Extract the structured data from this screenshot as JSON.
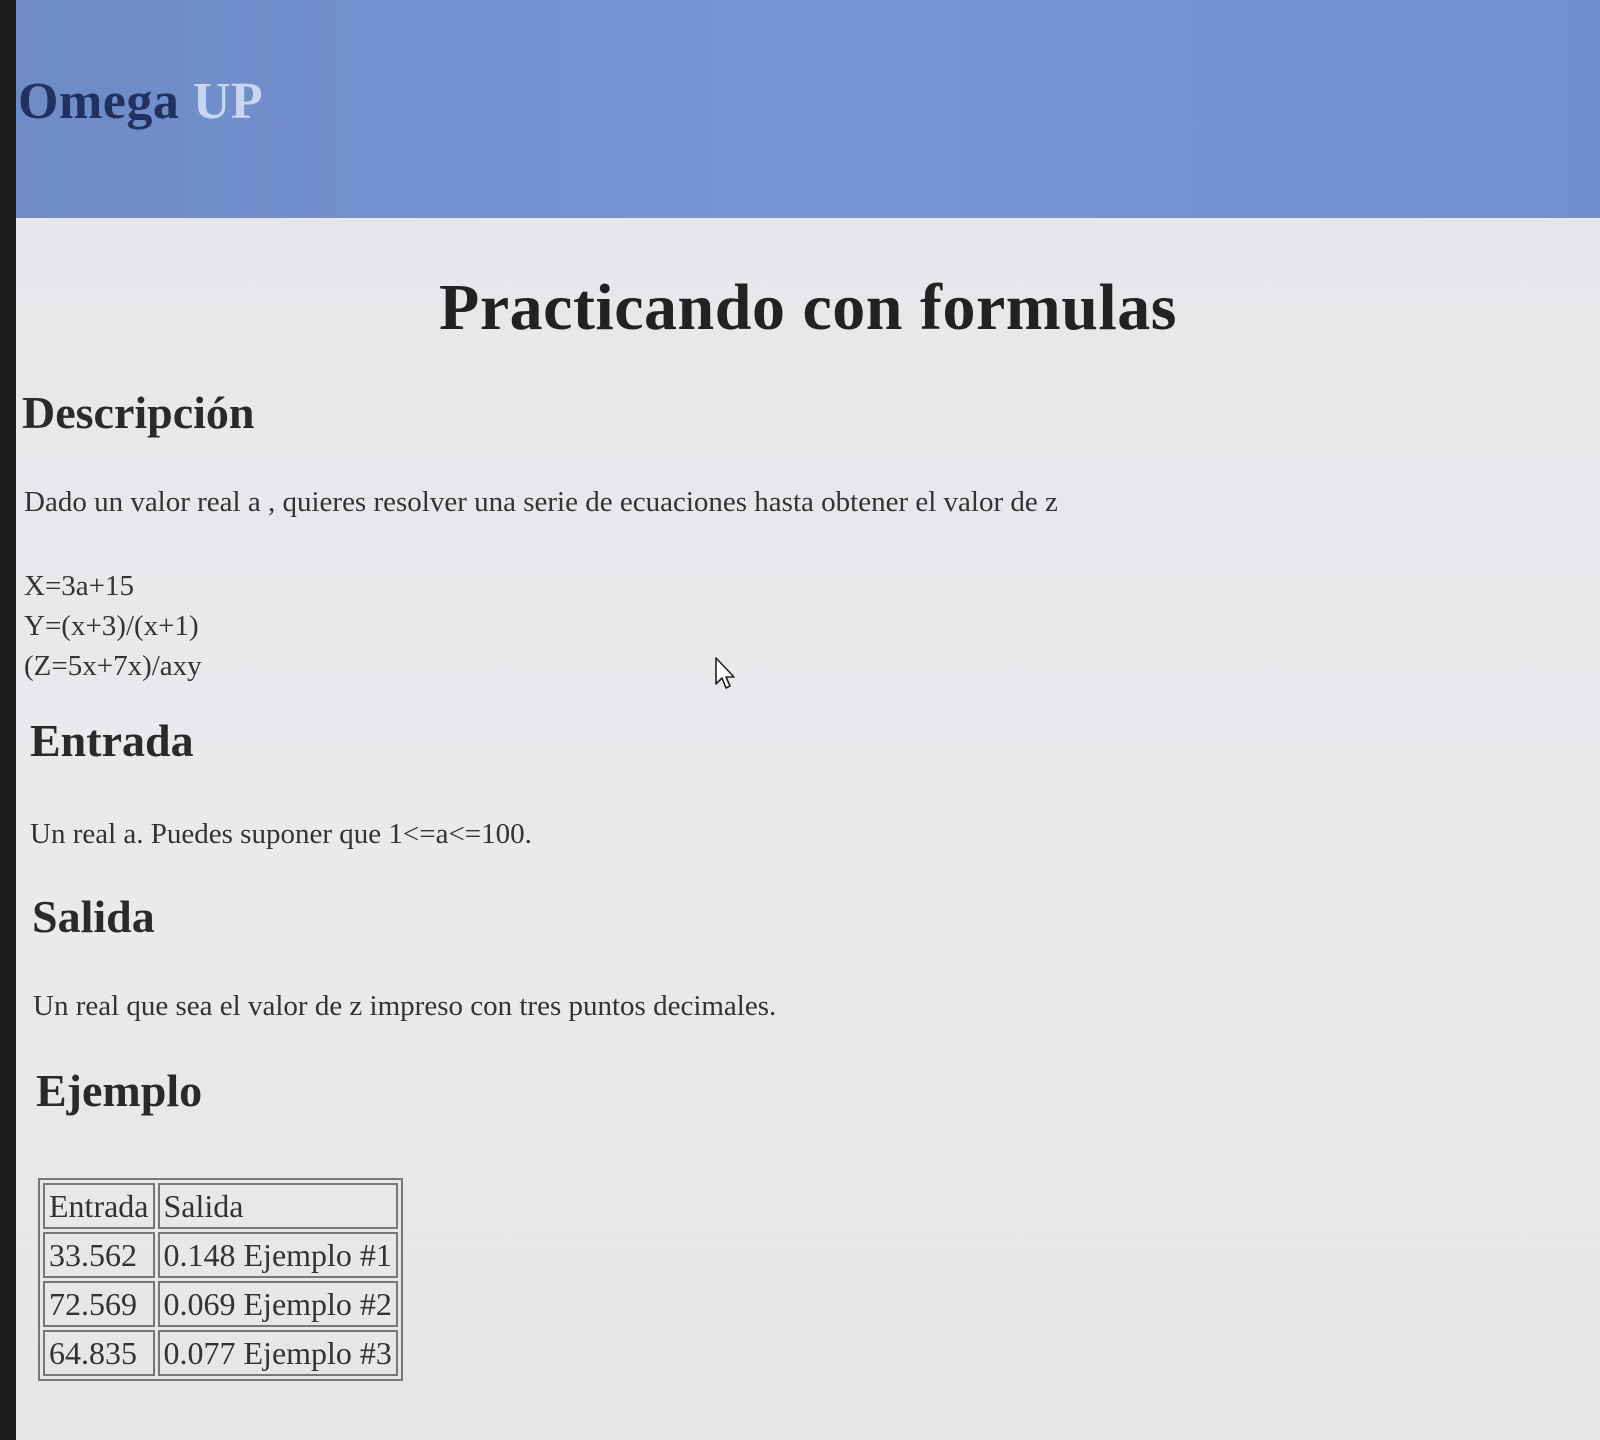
{
  "header": {
    "brand_part1": "Omega",
    "brand_part2": "UP"
  },
  "problem": {
    "title": "Practicando con formulas",
    "description_heading": "Descripción",
    "description_text": "Dado un valor real a , quieres resolver una serie de ecuaciones hasta obtener el valor de z",
    "formulas": [
      "X=3a+15",
      "Y=(x+3)/(x+1)",
      "(Z=5x+7x)/axy"
    ],
    "input_heading": "Entrada",
    "input_text": "Un real a. Puedes suponer que 1<=a<=100.",
    "output_heading": "Salida",
    "output_text": "Un real que sea el valor de z impreso con tres puntos decimales.",
    "example_heading": "Ejemplo",
    "example_table": {
      "headers": [
        "Entrada",
        "Salida"
      ],
      "rows": [
        [
          "33.562",
          "0.148 Ejemplo #1"
        ],
        [
          "72.569",
          "0.069 Ejemplo #2"
        ],
        [
          "64.835",
          "0.077 Ejemplo #3"
        ]
      ]
    }
  },
  "colors": {
    "header_bg": "#7796d4",
    "brand_dark": "#213260",
    "brand_light": "#c9d6f1"
  },
  "icons": {
    "cursor": "mouse-pointer-icon"
  }
}
